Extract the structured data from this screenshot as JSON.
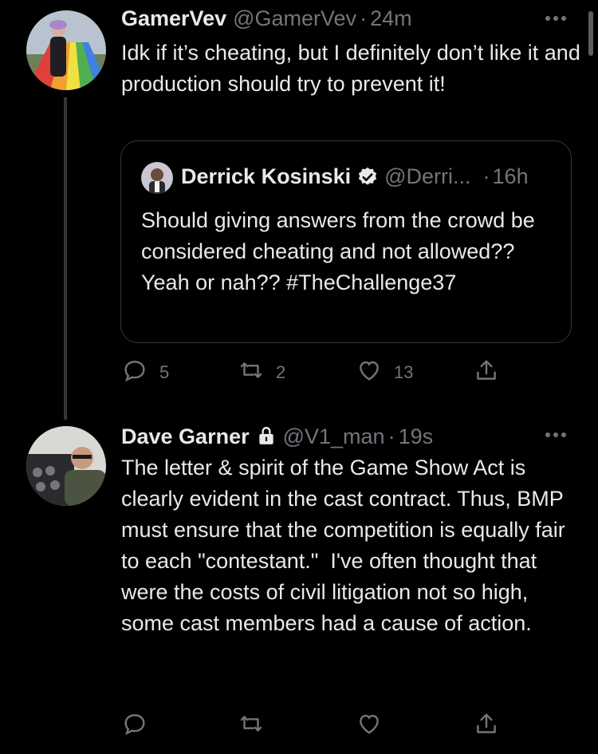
{
  "tweet1": {
    "display_name": "GamerVev",
    "handle": "@GamerVev",
    "time": "24m",
    "text": "Idk if it’s cheating, but I definitely don’t like it and production should try to prevent it!",
    "more_icon": "more-horizontal-icon",
    "quote": {
      "display_name": "Derrick Kosinski",
      "handle": "@Derri...",
      "time": "16h",
      "verified_icon": "verified-badge-icon",
      "text": "Should giving answers from the crowd be considered cheating and not allowed?? Yeah or nah?? #TheChallenge37"
    },
    "actions": {
      "reply_count": "5",
      "retweet_count": "2",
      "like_count": "13"
    }
  },
  "tweet2": {
    "display_name": "Dave Garner",
    "lock_icon": "lock-icon",
    "handle": "@V1_man",
    "time": "19s",
    "text": "The letter & spirit of the Game Show Act is clearly evident in the cast contract. Thus, BMP must ensure that the competition is equally fair to each \"contestant.\"  I've often thought that were the costs of civil litigation not so high, some cast members had a cause of action.",
    "more_icon": "more-horizontal-icon"
  },
  "separator": "·",
  "colors": {
    "background": "#000000",
    "text": "#e7e9ea",
    "muted": "#71767b",
    "border": "#333639"
  }
}
